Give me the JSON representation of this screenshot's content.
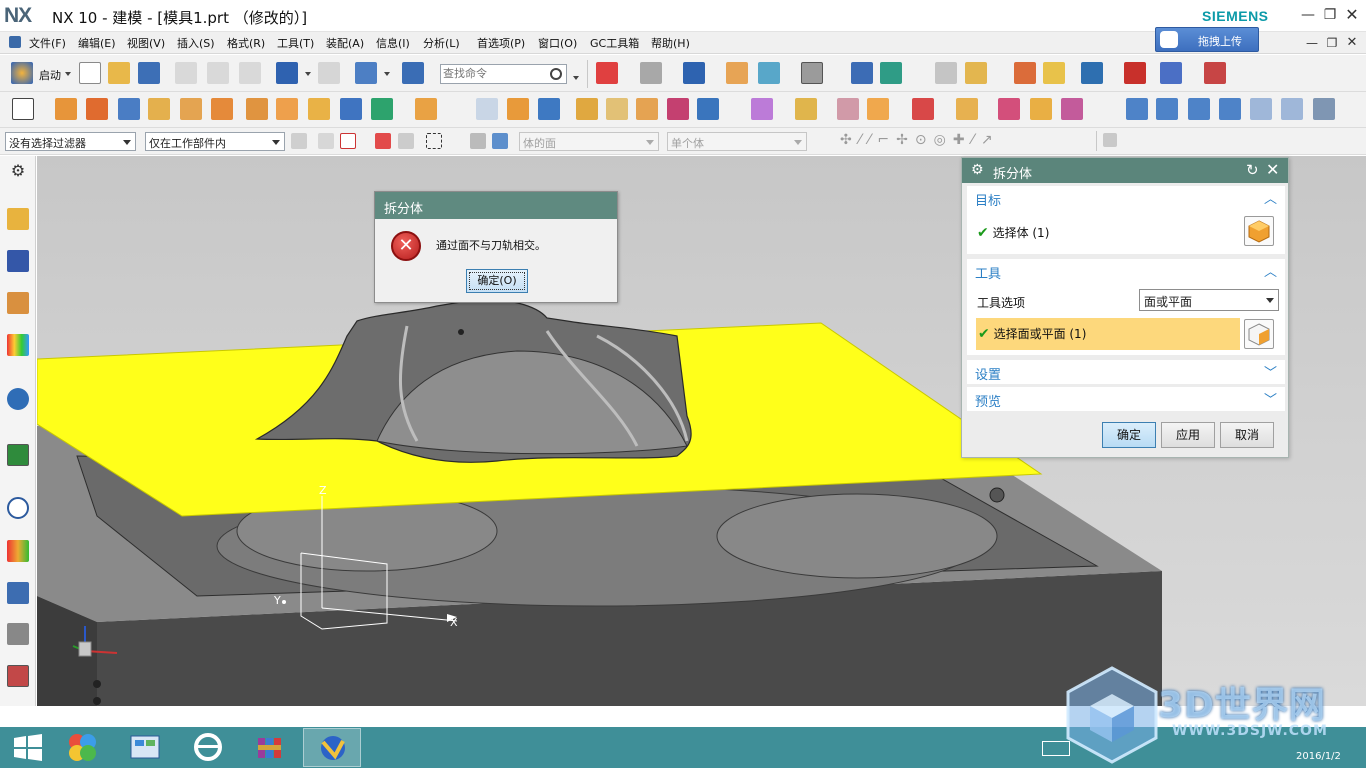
{
  "window": {
    "logo": "NX",
    "title": "NX 10 - 建模 - [模具1.prt （修改的）]",
    "brand": "SIEMENS"
  },
  "menu": {
    "items": [
      "文件(F)",
      "编辑(E)",
      "视图(V)",
      "插入(S)",
      "格式(R)",
      "工具(T)",
      "装配(A)",
      "信息(I)",
      "分析(L)",
      "首选项(P)",
      "窗口(O)",
      "GC工具箱",
      "帮助(H)"
    ]
  },
  "upload": {
    "label": "拖拽上传"
  },
  "toolbar": {
    "start_label": "启动",
    "search_placeholder": "查找命令"
  },
  "selection_bar": {
    "filter": "没有选择过滤器",
    "scope": "仅在工作部件内",
    "face_rule": "体的面",
    "body_rule": "单个体"
  },
  "error_dialog": {
    "title": "拆分体",
    "message": "通过面不与刀轨相交。",
    "ok_label": "确定(O)"
  },
  "split_dialog": {
    "title": "拆分体",
    "target": {
      "header": "目标",
      "select_body": "选择体 (1)"
    },
    "tool": {
      "header": "工具",
      "option_label": "工具选项",
      "option_value": "面或平面",
      "select_face": "选择面或平面 (1)"
    },
    "settings_header": "设置",
    "preview_header": "预览",
    "buttons": {
      "ok": "确定",
      "apply": "应用",
      "cancel": "取消"
    }
  },
  "viewport": {
    "axes": {
      "x": "X",
      "y": "Y",
      "z": "Z"
    },
    "colors": {
      "plane": "#ffff1a",
      "model": "#6e6e6e",
      "background": "#cdcdcd"
    }
  },
  "taskbar": {
    "date": "2016/1/2"
  },
  "watermark": {
    "text": "3D世界网",
    "url": "WWW.3DSJW.COM"
  }
}
